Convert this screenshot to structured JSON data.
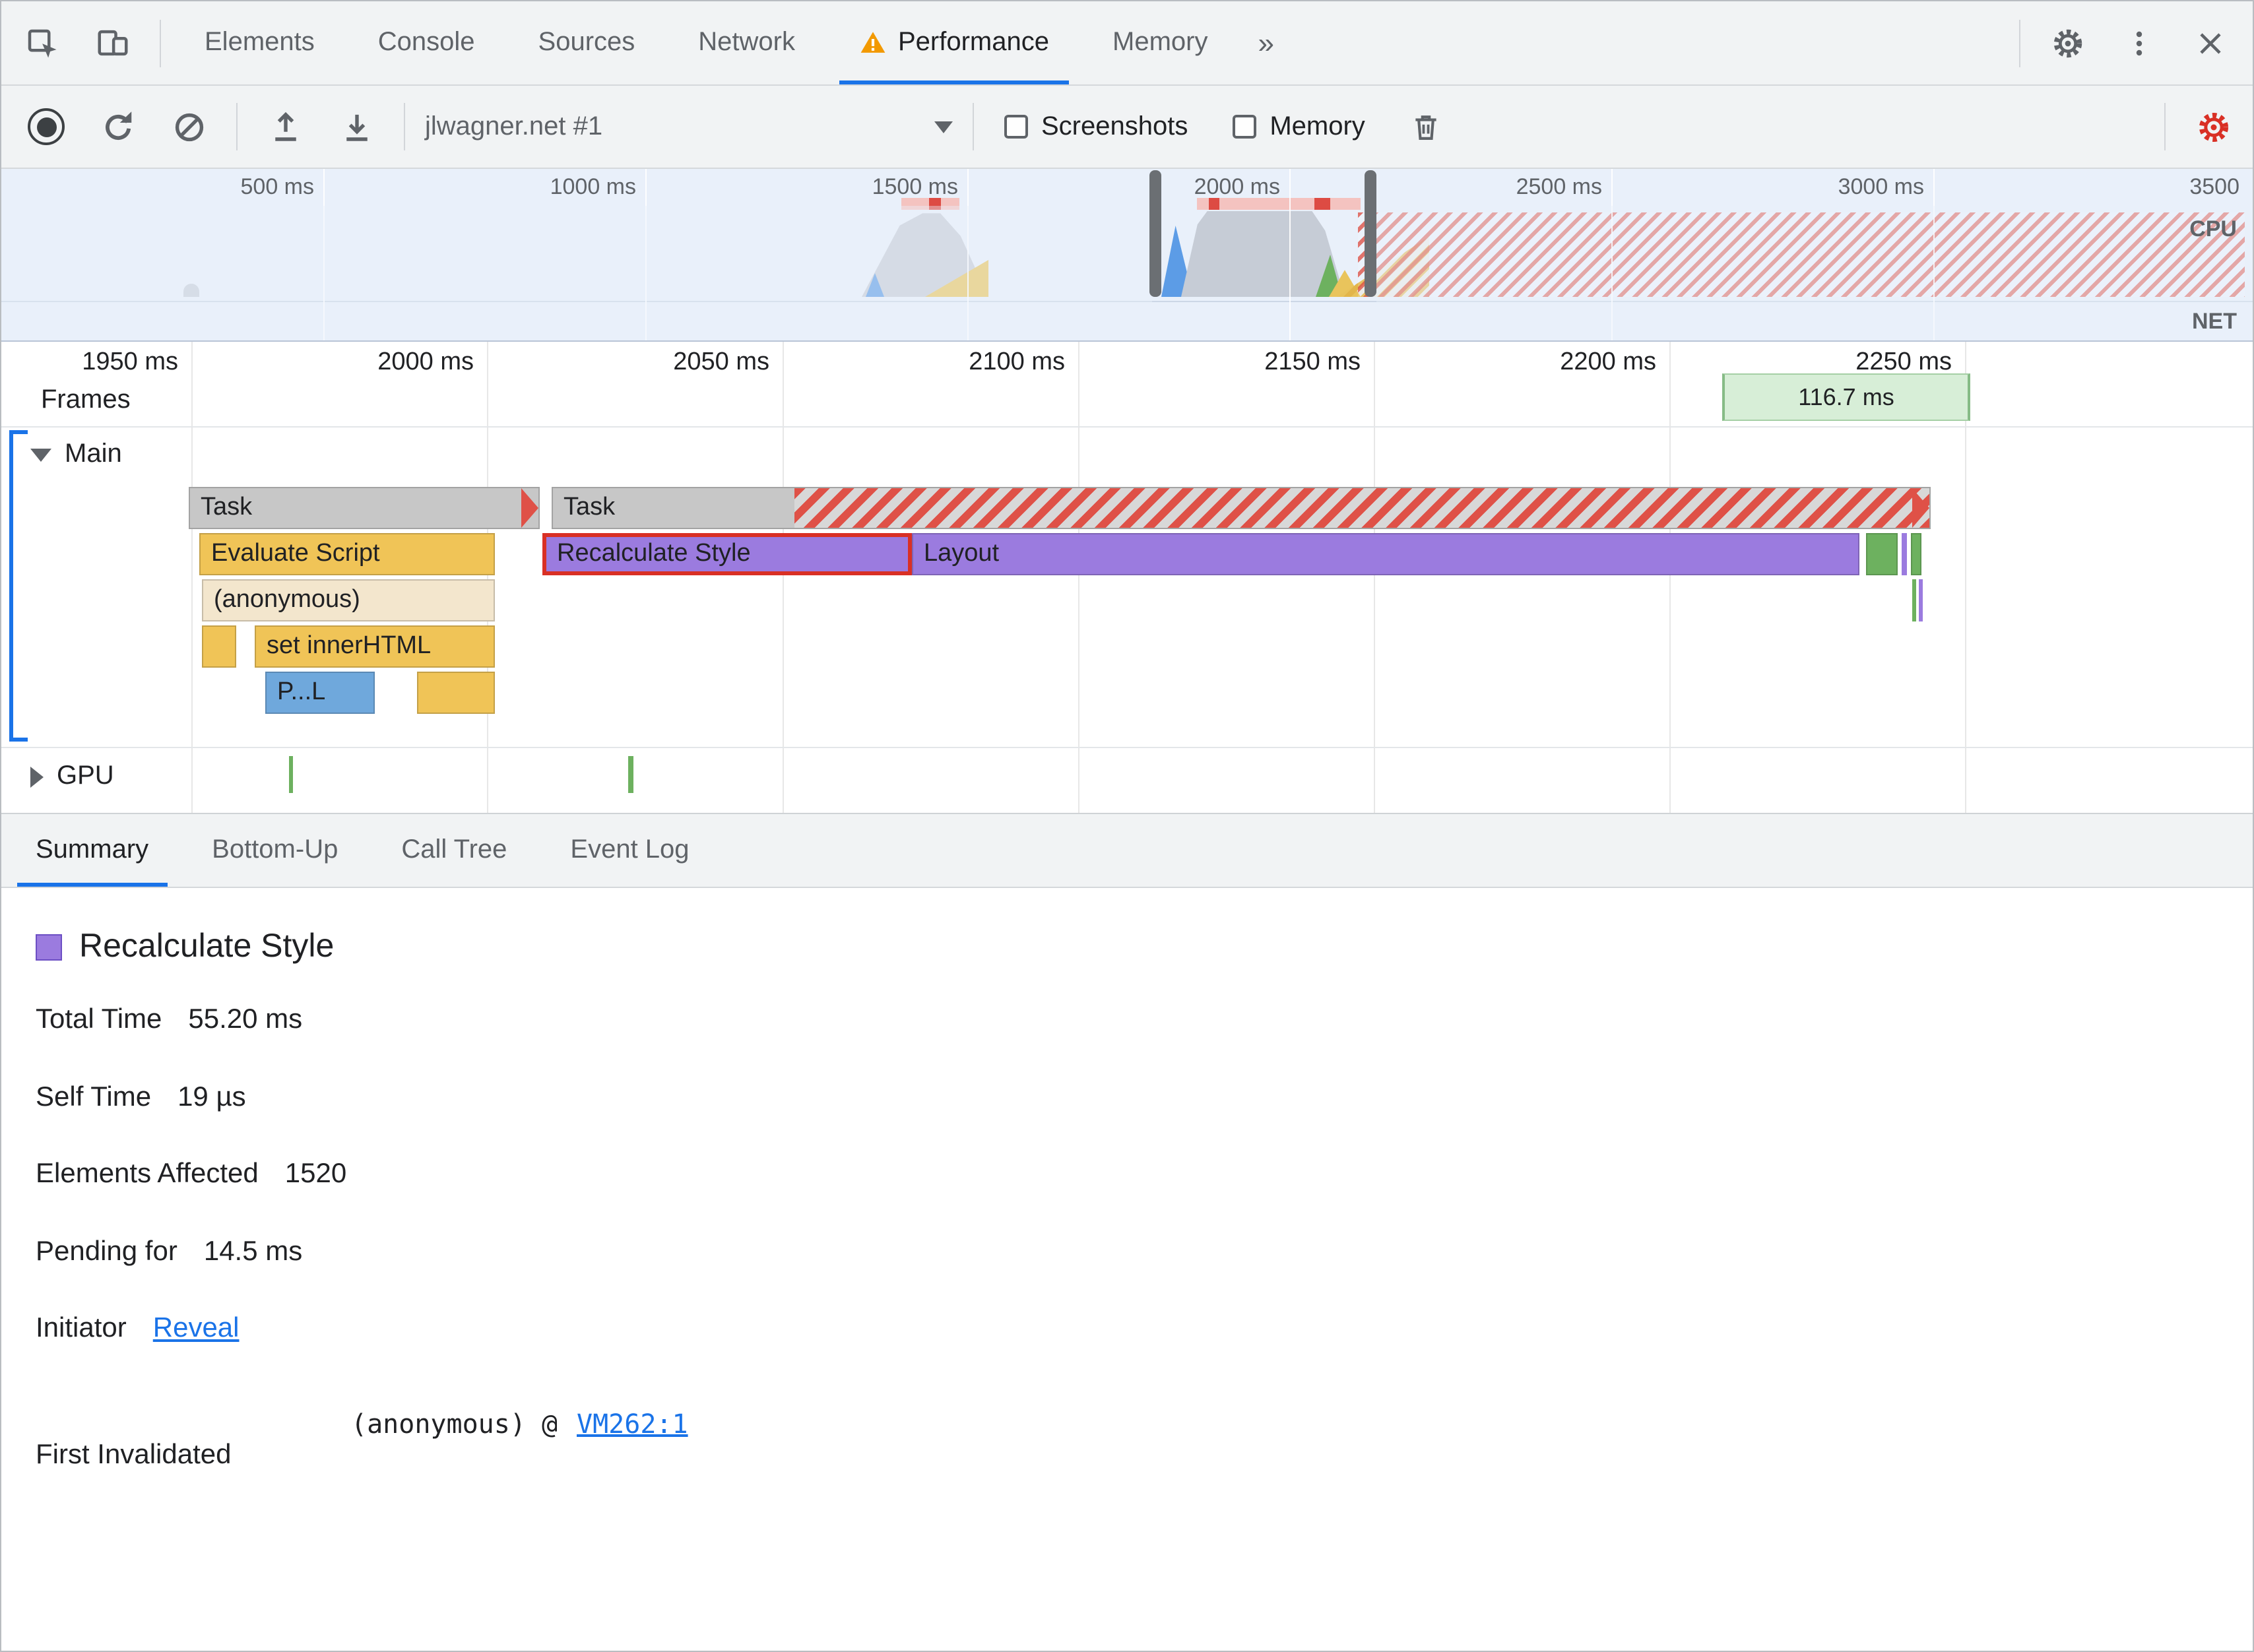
{
  "colors": {
    "accent_blue": "#1a73e8",
    "warning_orange": "#f29900",
    "record_settings_red": "#d93025",
    "scripting_yellow": "#f0c457",
    "rendering_purple": "#9b7bdf",
    "painting_green": "#6db15f",
    "task_gray": "#c7c7c7",
    "long_task_red": "#df5147",
    "frame_green_bg": "#d7eed7",
    "link_blue": "#1a73e8"
  },
  "devtools_tabs": {
    "items": [
      {
        "label": "Elements"
      },
      {
        "label": "Console"
      },
      {
        "label": "Sources"
      },
      {
        "label": "Network"
      },
      {
        "label": "Performance",
        "warning": true,
        "active": true
      },
      {
        "label": "Memory"
      }
    ],
    "more": "»"
  },
  "perf_toolbar": {
    "profile_name": "jlwagner.net #1",
    "screenshots_label": "Screenshots",
    "screenshots_checked": false,
    "memory_label": "Memory",
    "memory_checked": false
  },
  "overview": {
    "ruler_labels": [
      "500 ms",
      "1000 ms",
      "1500 ms",
      "2000 ms",
      "2500 ms",
      "3000 ms",
      "3500"
    ],
    "cpu_label": "CPU",
    "net_label": "NET"
  },
  "detail": {
    "ruler_labels": [
      "1950 ms",
      "2000 ms",
      "2050 ms",
      "2100 ms",
      "2150 ms",
      "2200 ms",
      "2250 ms"
    ],
    "frames_label": "Frames",
    "frame_duration": "116.7 ms",
    "main_track_label": "Main",
    "gpu_track_label": "GPU",
    "bars": {
      "task1": "Task",
      "task2": "Task",
      "evaluate_script": "Evaluate Script",
      "recalculate_style": "Recalculate Style",
      "layout": "Layout",
      "anonymous": "(anonymous)",
      "set_inner_html": "set innerHTML",
      "parse_html_truncated": "P...L"
    }
  },
  "bottom_tabs": {
    "items": [
      {
        "label": "Summary",
        "active": true
      },
      {
        "label": "Bottom-Up"
      },
      {
        "label": "Call Tree"
      },
      {
        "label": "Event Log"
      }
    ]
  },
  "summary": {
    "title": "Recalculate Style",
    "rows": [
      {
        "label": "Total Time",
        "value": "55.20 ms"
      },
      {
        "label": "Self Time",
        "value": "19 µs"
      },
      {
        "label": "Elements Affected",
        "value": "1520"
      },
      {
        "label": "Pending for",
        "value": "14.5 ms"
      }
    ],
    "initiator_label": "Initiator",
    "initiator_link": "Reveal",
    "first_invalidated_label": "First Invalidated",
    "first_invalidated_source": "(anonymous) @",
    "first_invalidated_link": "VM262:1"
  }
}
